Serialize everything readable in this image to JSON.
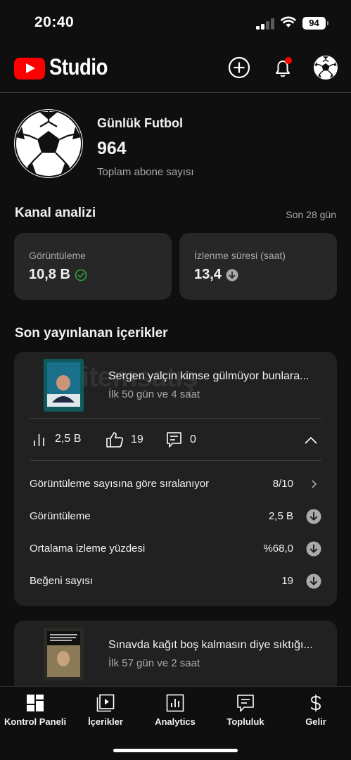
{
  "status_bar": {
    "time": "20:40",
    "battery": "94"
  },
  "header": {
    "brand": "Studio"
  },
  "channel": {
    "name": "Günlük Futbol",
    "subscribers": "964",
    "subscribers_label": "Toplam abone sayısı"
  },
  "analytics": {
    "title": "Kanal analizi",
    "period": "Son 28 gün",
    "cards": [
      {
        "label": "Görüntüleme",
        "value": "10,8 B",
        "status_icon": "check-circle-icon",
        "status_color": "#2ba640"
      },
      {
        "label": "İzlenme süresi (saat)",
        "value": "13,4",
        "status_icon": "arrow-down-circle-icon",
        "status_color": "#aaaaaa"
      }
    ]
  },
  "recent": {
    "title": "Son yayınlanan içerikler",
    "watermark": "itemsatış",
    "items": [
      {
        "title": "Sergen yalçın kimse gülmüyor bunlara...",
        "age": "İlk 50 gün ve 4 saat",
        "views": "2,5 B",
        "likes": "19",
        "comments": "0",
        "details": [
          {
            "label": "Görüntüleme sayısına göre sıralanıyor",
            "value": "8/10",
            "icon": "chevron-right-icon"
          },
          {
            "label": "Görüntüleme",
            "value": "2,5 B",
            "icon": "arrow-down-circle-icon"
          },
          {
            "label": "Ortalama izleme yüzdesi",
            "value": "%68,0",
            "icon": "arrow-down-circle-icon"
          },
          {
            "label": "Beğeni sayısı",
            "value": "19",
            "icon": "arrow-down-circle-icon"
          }
        ]
      },
      {
        "title": "Sınavda kağıt boş kalmasın diye sıktığı...",
        "age": "İlk 57 gün ve 2 saat"
      }
    ]
  },
  "bottom_nav": [
    {
      "label": "Kontrol Paneli",
      "icon": "dashboard-icon"
    },
    {
      "label": "İçerikler",
      "icon": "content-icon"
    },
    {
      "label": "Analytics",
      "icon": "analytics-icon"
    },
    {
      "label": "Topluluk",
      "icon": "community-icon"
    },
    {
      "label": "Gelir",
      "icon": "earn-icon"
    }
  ],
  "colors": {
    "background": "#0f0f0f",
    "card": "#272727",
    "accent_red": "#ff0000",
    "notification_dot": "#ff0000"
  }
}
